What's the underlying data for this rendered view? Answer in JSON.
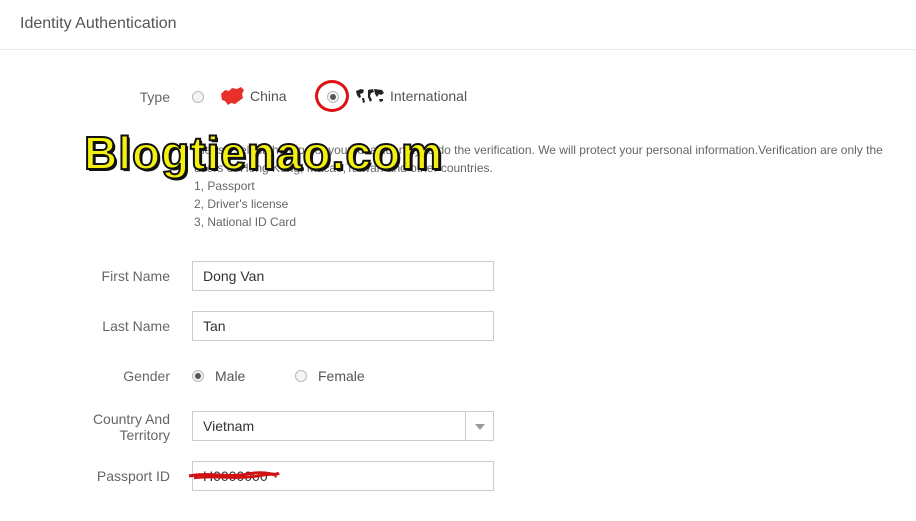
{
  "header": {
    "title": "Identity Authentication"
  },
  "type_row": {
    "label": "Type",
    "options": [
      {
        "label": "China",
        "checked": false,
        "icon": "china-map-icon"
      },
      {
        "label": "International",
        "checked": true,
        "icon": "world-map-icon"
      }
    ]
  },
  "description": {
    "line1": "Please select the type of your local identity to do the verification. We will protect your personal information.Verification are only the",
    "line2": "users of Hong Kong, Macao,Taiwan and other countries.",
    "items": [
      "1, Passport",
      "2, Driver's license",
      "3, National ID Card"
    ]
  },
  "watermark": "Blogtienao.com",
  "form": {
    "first_name": {
      "label": "First Name",
      "value": "Dong Van"
    },
    "last_name": {
      "label": "Last Name",
      "value": "Tan"
    },
    "gender": {
      "label": "Gender",
      "options": [
        {
          "label": "Male",
          "checked": true
        },
        {
          "label": "Female",
          "checked": false
        }
      ]
    },
    "country": {
      "label_line1": "Country And",
      "label_line2": "Territory",
      "value": "Vietnam"
    },
    "passport": {
      "label": "Passport ID",
      "value": "H0000000"
    }
  },
  "colors": {
    "watermark_fill": "#f3f00e",
    "annotation_red": "#d11111",
    "china_red": "#e8302a"
  }
}
